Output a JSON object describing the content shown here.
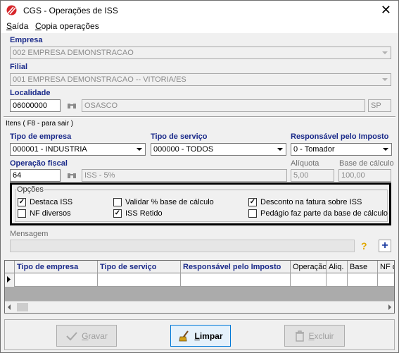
{
  "window": {
    "title": "CGS - Operações de ISS"
  },
  "menu": {
    "items": [
      {
        "accel": "S",
        "rest": "aída"
      },
      {
        "accel": "C",
        "rest": "opia operações"
      }
    ]
  },
  "empresa": {
    "label": "Empresa",
    "value": "002 EMPRESA DEMONSTRACAO"
  },
  "filial": {
    "label": "Filial",
    "value": "001 EMPRESA DEMONSTRACAO -- VITORIA/ES"
  },
  "localidade": {
    "label": "Localidade",
    "code": "06000000",
    "name": "OSASCO",
    "uf": "SP"
  },
  "itens": {
    "label": "Itens ( F8 - para sair )"
  },
  "tipo_empresa": {
    "label": "Tipo de empresa",
    "value": "000001 - INDUSTRIA"
  },
  "tipo_servico": {
    "label": "Tipo de serviço",
    "value": "000000 - TODOS"
  },
  "responsavel": {
    "label": "Responsável pelo Imposto",
    "value": "0 - Tomador"
  },
  "operacao": {
    "label": "Operação fiscal",
    "code": "64",
    "desc": "ISS - 5%"
  },
  "aliquota": {
    "label": "Alíquota",
    "value": "5,00"
  },
  "base": {
    "label": "Base de cálculo",
    "value": "100,00"
  },
  "opcoes": {
    "legend": "Opções",
    "items": [
      {
        "label": "Destaca ISS",
        "checked": true
      },
      {
        "label": "NF diversos",
        "checked": false
      },
      {
        "label": "Validar % base de cálculo",
        "checked": false
      },
      {
        "label": "ISS Retido",
        "checked": true
      },
      {
        "label": "Desconto na fatura sobre ISS",
        "checked": true
      },
      {
        "label": "Pedágio faz parte da base de cálculo",
        "checked": false
      }
    ]
  },
  "mensagem": {
    "label": "Mensagem"
  },
  "grid": {
    "columns": [
      "Tipo de empresa",
      "Tipo de serviço",
      "Responsável pelo Imposto",
      "Operação",
      "Aliq.",
      "Base",
      "NF d"
    ]
  },
  "buttons": {
    "gravar": {
      "accel": "G",
      "rest": "ravar"
    },
    "limpar": {
      "accel": "L",
      "rest": "impar"
    },
    "excluir": {
      "accel": "E",
      "rest": "xcluir"
    }
  }
}
